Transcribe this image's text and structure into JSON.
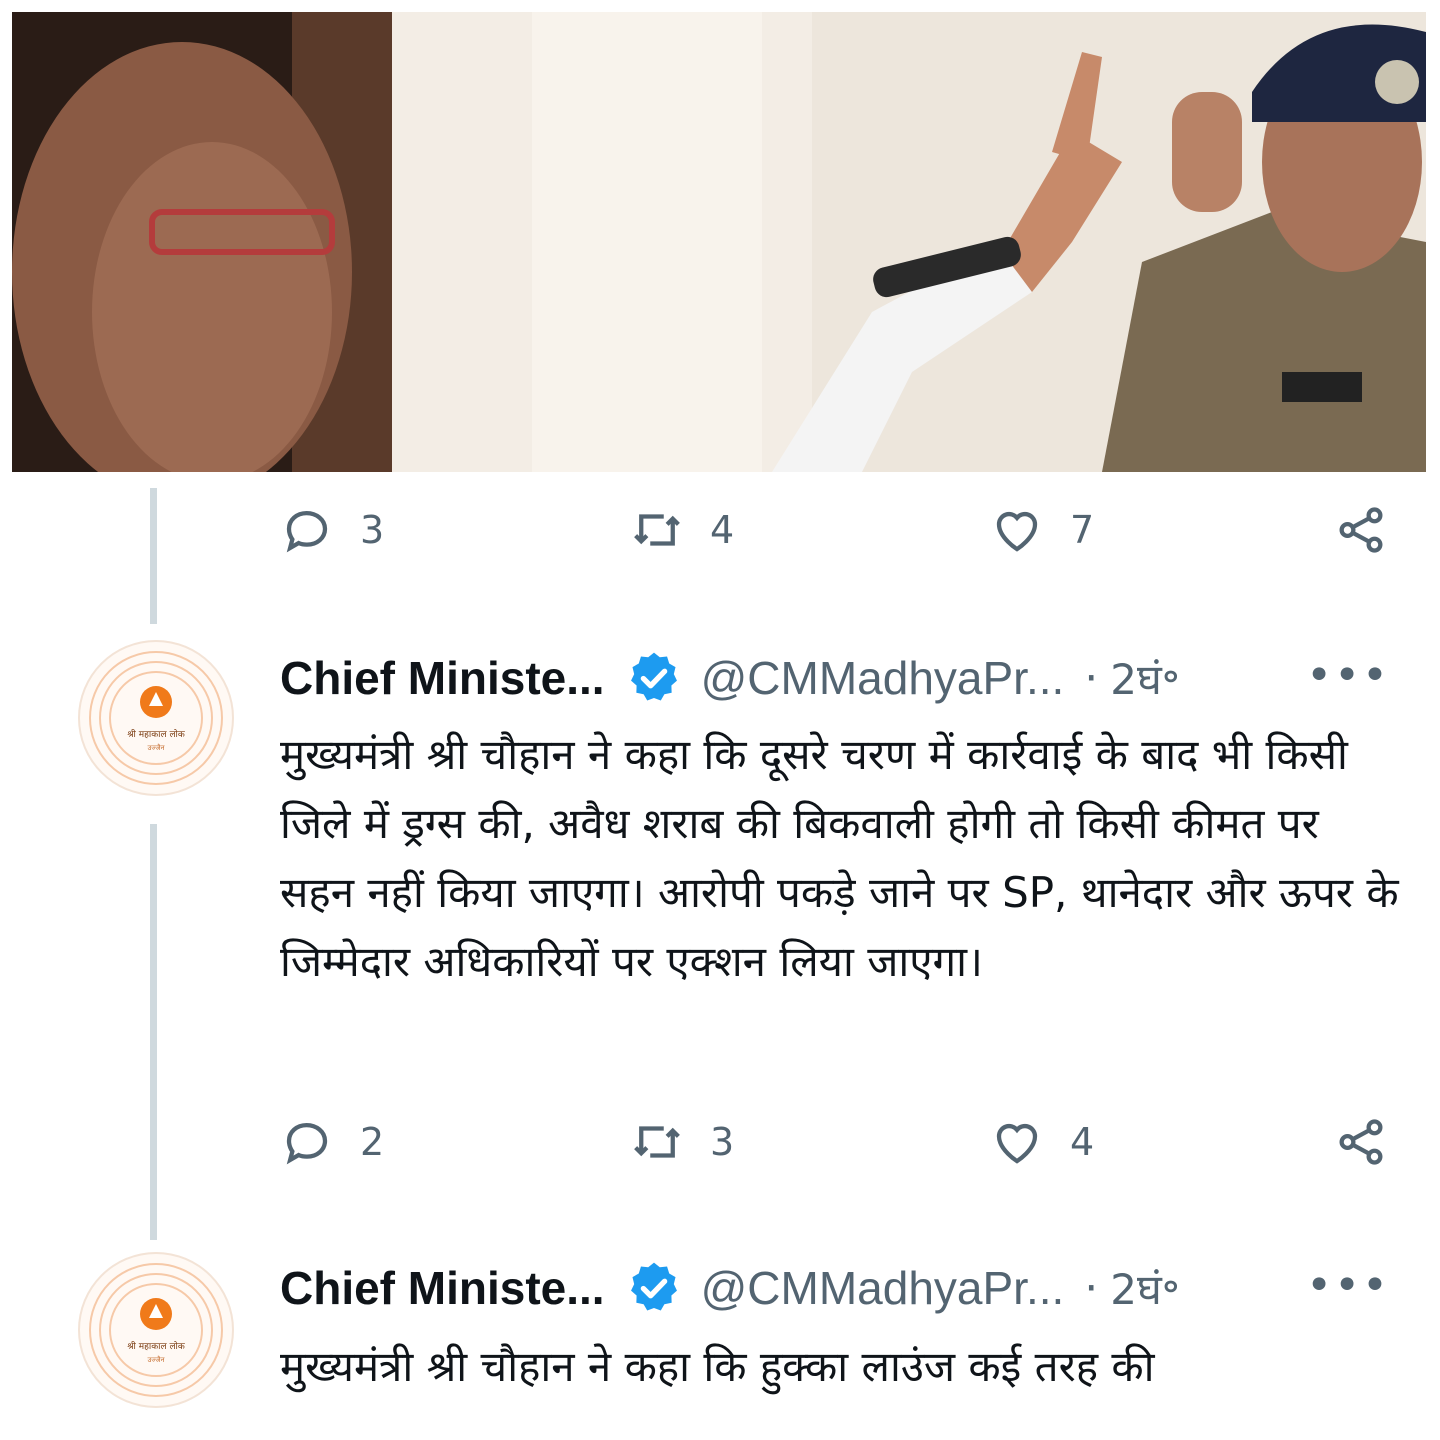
{
  "photo": {
    "description_icon": "news-photo"
  },
  "tweets": [
    {
      "actions": {
        "replies": "3",
        "retweets": "4",
        "likes": "7"
      }
    },
    {
      "author_name": "Chief Ministe...",
      "handle": "@CMMadhyaPr...",
      "separator": "·",
      "time": "2घं॰",
      "more": "•••",
      "text": "मुख्यमंत्री श्री चौहान ने कहा कि दूसरे चरण में कार्रवाई के बाद भी किसी जिले में ड्रग्स की, अवैध शराब की बिकवाली होगी तो किसी कीमत पर सहन नहीं किया जाएगा। आरोपी पकड़े जाने पर SP, थानेदार और ऊपर के जिम्मेदार अधिकारियों पर एक्शन लिया जाएगा।",
      "actions": {
        "replies": "2",
        "retweets": "3",
        "likes": "4"
      }
    },
    {
      "author_name": "Chief Ministe...",
      "handle": "@CMMadhyaPr...",
      "separator": "·",
      "time": "2घं॰",
      "more": "•••",
      "text": "मुख्यमंत्री श्री चौहान ने कहा कि हुक्का लाउंज कई तरह की"
    }
  ],
  "avatar_logo_text": "श्री महाकाल लोक",
  "avatar_logo_subtext": "उज्जैन",
  "colors": {
    "verified": "#1d9bf0",
    "icon": "#536471",
    "thread_line": "#cfd9de",
    "logo_orange": "#f07a1a"
  }
}
